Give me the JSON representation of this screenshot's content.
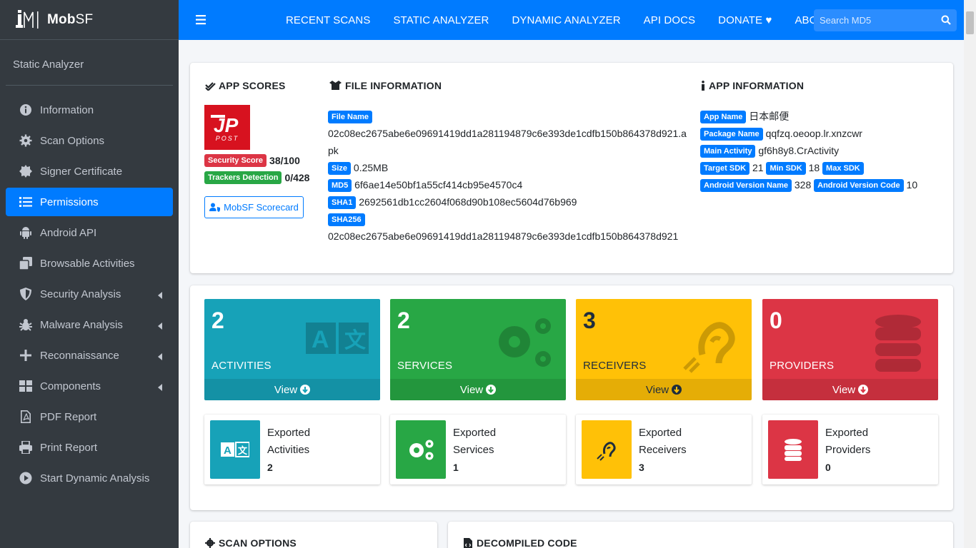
{
  "brand": {
    "name_bold": "Mob",
    "name_light": "SF"
  },
  "sidebar": {
    "section": "Static Analyzer",
    "items": [
      {
        "label": "Information",
        "icon": "info-circle-icon",
        "active": false,
        "arrow": false
      },
      {
        "label": "Scan Options",
        "icon": "gear-icon",
        "active": false,
        "arrow": false
      },
      {
        "label": "Signer Certificate",
        "icon": "certificate-icon",
        "active": false,
        "arrow": false
      },
      {
        "label": "Permissions",
        "icon": "list-icon",
        "active": true,
        "arrow": false
      },
      {
        "label": "Android API",
        "icon": "android-icon",
        "active": false,
        "arrow": false
      },
      {
        "label": "Browsable Activities",
        "icon": "clone-icon",
        "active": false,
        "arrow": false
      },
      {
        "label": "Security Analysis",
        "icon": "shield-icon",
        "active": false,
        "arrow": true
      },
      {
        "label": "Malware Analysis",
        "icon": "bug-icon",
        "active": false,
        "arrow": true
      },
      {
        "label": "Reconnaissance",
        "icon": "plus-icon",
        "active": false,
        "arrow": true
      },
      {
        "label": "Components",
        "icon": "grid-icon",
        "active": false,
        "arrow": true
      },
      {
        "label": "PDF Report",
        "icon": "pdf-file-icon",
        "active": false,
        "arrow": false
      },
      {
        "label": "Print Report",
        "icon": "print-icon",
        "active": false,
        "arrow": false
      },
      {
        "label": "Start Dynamic Analysis",
        "icon": "play-circle-icon",
        "active": false,
        "arrow": false
      }
    ]
  },
  "topnav": {
    "links": [
      "RECENT SCANS",
      "STATIC ANALYZER",
      "DYNAMIC ANALYZER",
      "API DOCS",
      "DONATE",
      "ABOUT"
    ],
    "search_placeholder": "Search MD5"
  },
  "app_scores": {
    "title": "APP SCORES",
    "logo_text": "POST",
    "security_score_label": "Security Score",
    "security_score": "38/100",
    "trackers_label": "Trackers Detection",
    "trackers": "0/428",
    "scorecard_button": "MobSF Scorecard"
  },
  "file_info": {
    "title": "FILE INFORMATION",
    "file_name_label": "File Name",
    "file_name": "02c08ec2675abe6e09691419dd1a281194879c6e393de1cdfb150b864378d921.apk",
    "size_label": "Size",
    "size": "0.25MB",
    "md5_label": "MD5",
    "md5": "6f6ae14e50bf1a55cf414cb95e4570c4",
    "sha1_label": "SHA1",
    "sha1": "2692561db1cc2604f068d90b108ec5604d76b969",
    "sha256_label": "SHA256",
    "sha256": "02c08ec2675abe6e09691419dd1a281194879c6e393de1cdfb150b864378d921"
  },
  "app_info": {
    "title": "APP INFORMATION",
    "app_name_label": "App Name",
    "app_name": "日本邮便",
    "package_label": "Package Name",
    "package": "qqfzq.oeoop.lr.xnzcwr",
    "main_activity_label": "Main Activity",
    "main_activity": "gf6h8y8.CrActivity",
    "target_sdk_label": "Target SDK",
    "target_sdk": "21",
    "min_sdk_label": "Min SDK",
    "min_sdk": "18",
    "max_sdk_label": "Max SDK",
    "version_name_label": "Android Version Name",
    "version_name": "328",
    "version_code_label": "Android Version Code",
    "version_code": "10"
  },
  "stats": [
    {
      "count": "2",
      "label": "ACTIVITIES",
      "view": "View",
      "color": "#17a2b8"
    },
    {
      "count": "2",
      "label": "SERVICES",
      "view": "View",
      "color": "#28a745"
    },
    {
      "count": "3",
      "label": "RECEIVERS",
      "view": "View",
      "color": "#ffc107"
    },
    {
      "count": "0",
      "label": "PROVIDERS",
      "view": "View",
      "color": "#dc3545"
    }
  ],
  "exported": [
    {
      "line1": "Exported",
      "line2": "Activities",
      "count": "2"
    },
    {
      "line1": "Exported",
      "line2": "Services",
      "count": "1"
    },
    {
      "line1": "Exported",
      "line2": "Receivers",
      "count": "3"
    },
    {
      "line1": "Exported",
      "line2": "Providers",
      "count": "0"
    }
  ],
  "bottom_cards": {
    "scan_options": "SCAN OPTIONS",
    "decompiled_code": "DECOMPILED CODE"
  }
}
